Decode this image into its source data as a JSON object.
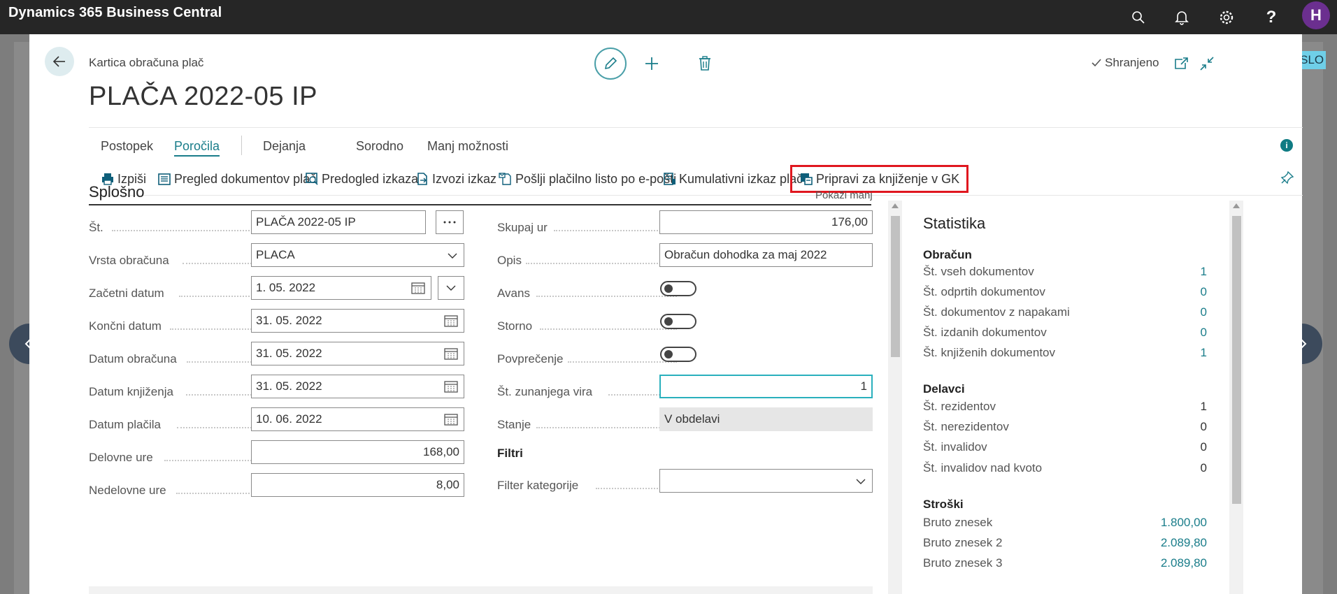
{
  "app": {
    "title": "Dynamics 365 Business Central",
    "avatar_initial": "H"
  },
  "topbar_icons": [
    "search-icon",
    "bell-icon",
    "gear-icon",
    "help-icon"
  ],
  "environment_badge": "CSLO",
  "header": {
    "breadcrumb": "Kartica obračuna plač",
    "title": "PLAČA 2022-05 IP",
    "saved_label": "Shranjeno"
  },
  "menu": {
    "items": [
      "Postopek",
      "Poročila",
      "Dejanja",
      "Sorodno",
      "Manj možnosti"
    ],
    "active": "Poročila"
  },
  "actions": [
    {
      "label": "Izpiši",
      "icon": "print-icon"
    },
    {
      "label": "Pregled dokumentov plač",
      "icon": "document-list-icon"
    },
    {
      "label": "Predogled izkaza",
      "icon": "preview-icon"
    },
    {
      "label": "Izvozi izkaz",
      "icon": "export-icon"
    },
    {
      "label": "Pošlji plačilno listo po e-pošti",
      "icon": "email-icon"
    },
    {
      "label": "Kumulativni izkaz plač",
      "icon": "report-icon"
    },
    {
      "label": "Pripravi za knjiženje v GK",
      "icon": "post-icon",
      "highlighted": true
    }
  ],
  "general": {
    "title": "Splošno",
    "show_less": "Pokaži manj",
    "left_fields": [
      {
        "label": "Št.",
        "value": "PLAČA 2022-05 IP"
      },
      {
        "label": "Vrsta obračuna",
        "value": "PLACA"
      },
      {
        "label": "Začetni datum",
        "value": "1. 05. 2022"
      },
      {
        "label": "Končni datum",
        "value": "31. 05. 2022"
      },
      {
        "label": "Datum obračuna",
        "value": "31. 05. 2022"
      },
      {
        "label": "Datum knjiženja",
        "value": "31. 05. 2022"
      },
      {
        "label": "Datum plačila",
        "value": "10. 06. 2022"
      },
      {
        "label": "Delovne ure",
        "value": "168,00"
      },
      {
        "label": "Nedelovne ure",
        "value": "8,00"
      }
    ],
    "right_fields": [
      {
        "label": "Skupaj ur",
        "value": "176,00"
      },
      {
        "label": "Opis",
        "value": "Obračun dohodka za maj 2022"
      },
      {
        "label": "Avans",
        "value": "off"
      },
      {
        "label": "Storno",
        "value": "off"
      },
      {
        "label": "Povprečenje",
        "value": "off"
      },
      {
        "label": "Št. zunanjega vira",
        "value": "1"
      },
      {
        "label": "Stanje",
        "value": "V obdelavi"
      }
    ],
    "filters_title": "Filtri",
    "filter_category_label": "Filter kategorije",
    "filter_category_value": ""
  },
  "statistics": {
    "title": "Statistika",
    "groups": [
      {
        "title": "Obračun",
        "rows": [
          {
            "label": "Št. vseh dokumentov",
            "value": "1"
          },
          {
            "label": "Št. odprtih dokumentov",
            "value": "0"
          },
          {
            "label": "Št. dokumentov z napakami",
            "value": "0"
          },
          {
            "label": "Št. izdanih dokumentov",
            "value": "0"
          },
          {
            "label": "Št. knjiženih dokumentov",
            "value": "1"
          }
        ]
      },
      {
        "title": "Delavci",
        "rows": [
          {
            "label": "Št. rezidentov",
            "value": "1"
          },
          {
            "label": "Št. nerezidentov",
            "value": "0"
          },
          {
            "label": "Št. invalidov",
            "value": "0"
          },
          {
            "label": "Št. invalidov nad kvoto",
            "value": "0"
          }
        ]
      },
      {
        "title": "Stroški",
        "rows": [
          {
            "label": "Bruto znesek",
            "value": "1.800,00"
          },
          {
            "label": "Bruto znesek 2",
            "value": "2.089,80"
          },
          {
            "label": "Bruto znesek 3",
            "value": "2.089,80"
          }
        ]
      }
    ]
  },
  "colors": {
    "accent": "#1a7d8a",
    "topbar": "#262626",
    "highlight_border": "#e0171f"
  }
}
